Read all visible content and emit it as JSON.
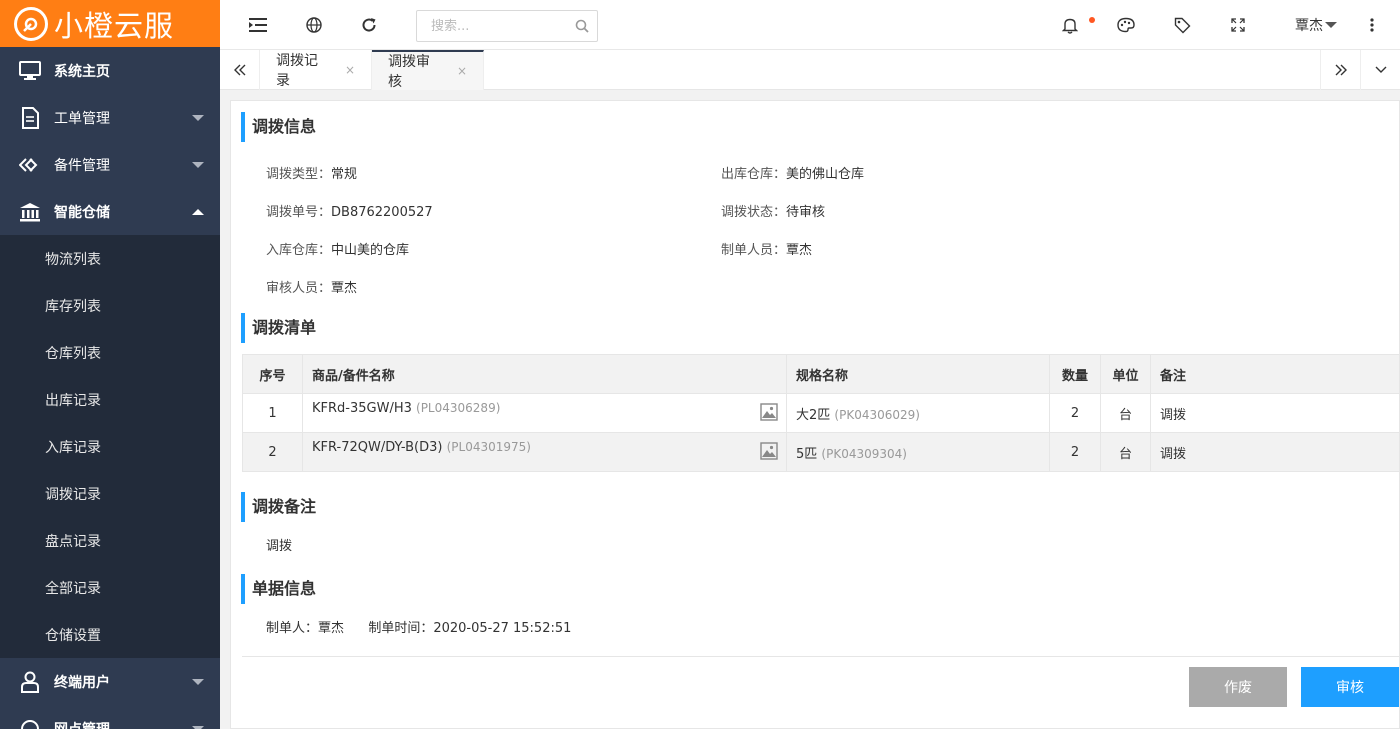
{
  "logo": {
    "text": "小橙云服"
  },
  "sidebar": {
    "items": [
      {
        "label": "系统主页",
        "icon": "monitor-icon"
      },
      {
        "label": "工单管理",
        "icon": "document-icon"
      },
      {
        "label": "备件管理",
        "icon": "diamond-icon"
      },
      {
        "label": "智能仓储",
        "icon": "bank-icon"
      }
    ],
    "submenu": [
      "物流列表",
      "库存列表",
      "仓库列表",
      "出库记录",
      "入库记录",
      "调拨记录",
      "盘点记录",
      "全部记录",
      "仓储设置"
    ],
    "bottom_items": [
      {
        "label": "终端用户",
        "icon": "user-icon"
      },
      {
        "label": "网点管理",
        "icon": "globe-icon"
      }
    ]
  },
  "topbar": {
    "search_placeholder": "搜索...",
    "user_name": "覃杰"
  },
  "tabs": [
    {
      "label": "调拨记录",
      "close": "×"
    },
    {
      "label": "调拨审核",
      "close": "×"
    }
  ],
  "transfer_info": {
    "title": "调拨信息",
    "fields": [
      {
        "key": "调拨类型：",
        "value": "常规"
      },
      {
        "key": "出库仓库：",
        "value": "美的佛山仓库"
      },
      {
        "key": "调拨单号：",
        "value": "DB8762200527"
      },
      {
        "key": "调拨状态：",
        "value": "待审核"
      },
      {
        "key": "入库仓库：",
        "value": "中山美的仓库"
      },
      {
        "key": "制单人员：",
        "value": "覃杰"
      },
      {
        "key": "审核人员：",
        "value": "覃杰"
      }
    ]
  },
  "transfer_list": {
    "title": "调拨清单",
    "headers": [
      "序号",
      "商品/备件名称",
      "规格名称",
      "数量",
      "单位",
      "备注"
    ],
    "rows": [
      {
        "no": "1",
        "name": "KFRd-35GW/H3",
        "name_code": "(PL04306289)",
        "spec": "大2匹",
        "spec_code": "(PK04306029)",
        "qty": "2",
        "unit": "台",
        "note": "调拨"
      },
      {
        "no": "2",
        "name": "KFR-72QW/DY-B(D3)",
        "name_code": "(PL04301975)",
        "spec": "5匹",
        "spec_code": "(PK04309304)",
        "qty": "2",
        "unit": "台",
        "note": "调拨"
      }
    ]
  },
  "transfer_remark": {
    "title": "调拨备注",
    "text": "调拨"
  },
  "bill_info": {
    "title": "单据信息",
    "creator_key": "制单人：",
    "creator": "覃杰",
    "time_key": "制单时间：",
    "time": "2020-05-27 15:52:51"
  },
  "buttons": {
    "void": "作废",
    "audit": "审核"
  },
  "colors": {
    "brand": "#ff7e14",
    "sidebar": "#2f3b51",
    "primary": "#1e9fff",
    "disabled": "#aaaaaa"
  }
}
